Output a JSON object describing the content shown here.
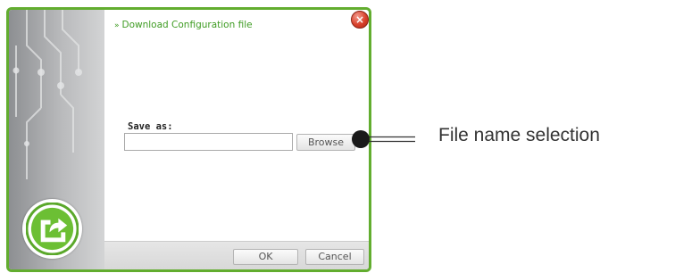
{
  "dialog": {
    "title": "Download Configuration file",
    "title_chevron": "»",
    "close_glyph": "×",
    "save_as_label": "Save as:",
    "filename_value": "",
    "browse_label": "Browse",
    "ok_label": "OK",
    "cancel_label": "Cancel"
  },
  "icons": {
    "close": "close-icon",
    "logo": "export-logo-icon",
    "circuit": "circuit-decoration"
  },
  "colors": {
    "border_green": "#62ad2f",
    "title_green": "#3f9c23",
    "close_red": "#d8402b",
    "side_panel_gray": "#b9babc"
  },
  "annotation": {
    "label": "File name selection"
  }
}
